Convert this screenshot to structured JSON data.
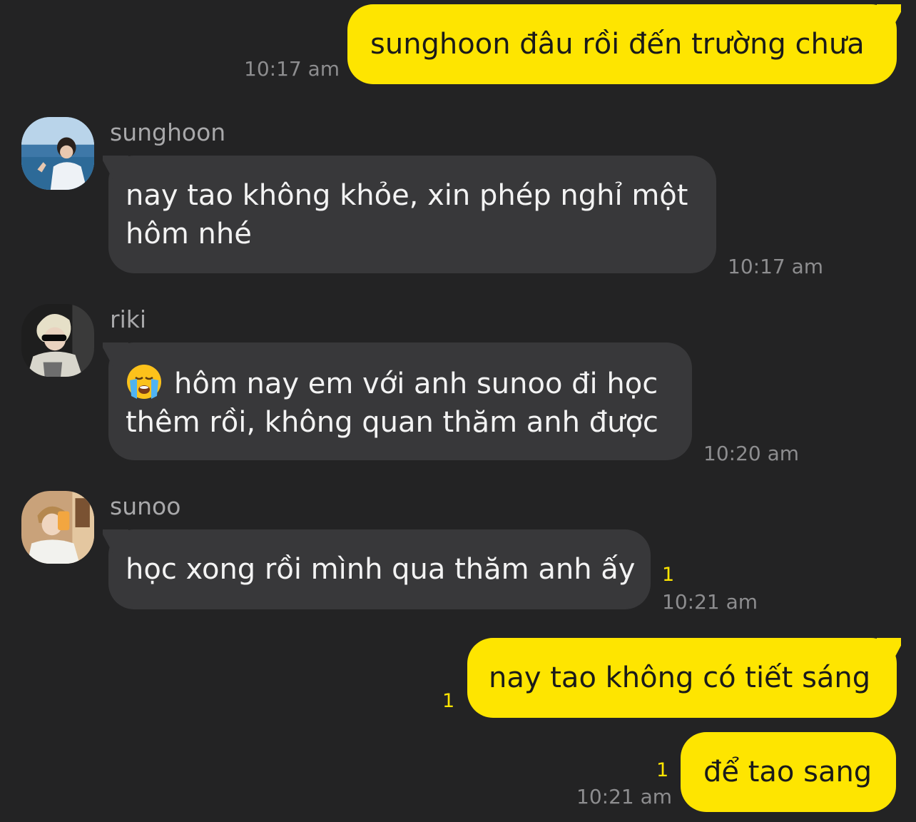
{
  "colors": {
    "background": "#232324",
    "outgoing_bubble": "#fee500",
    "incoming_bubble": "#38383a",
    "unread_count": "#fee500",
    "timestamp": "#8d8d8f"
  },
  "messages": [
    {
      "direction": "out",
      "text": "sunghoon đâu rồi đến trường chưa",
      "time": "10:17 am"
    },
    {
      "direction": "in",
      "sender": "sunghoon",
      "avatar": "avatar-sunghoon",
      "text_line1": "nay tao không khỏe, xin phép nghỉ một",
      "text_line2": "hôm nhé",
      "time": "10:17 am"
    },
    {
      "direction": "in",
      "sender": "riki",
      "avatar": "avatar-riki",
      "emoji": "loudly-crying-face-emoji",
      "text_line1": "hôm nay em với anh sunoo đi học",
      "text_line2": "thêm rồi, không quan thăm anh được",
      "time": "10:20 am"
    },
    {
      "direction": "in",
      "sender": "sunoo",
      "avatar": "avatar-sunoo",
      "text": "học xong rồi mình qua thăm anh ấy",
      "unread": "1",
      "time": "10:21 am"
    },
    {
      "direction": "out",
      "text": "nay tao không có tiết sáng",
      "unread": "1"
    },
    {
      "direction": "out",
      "text": "để tao sang",
      "unread": "1",
      "time": "10:21 am"
    }
  ]
}
